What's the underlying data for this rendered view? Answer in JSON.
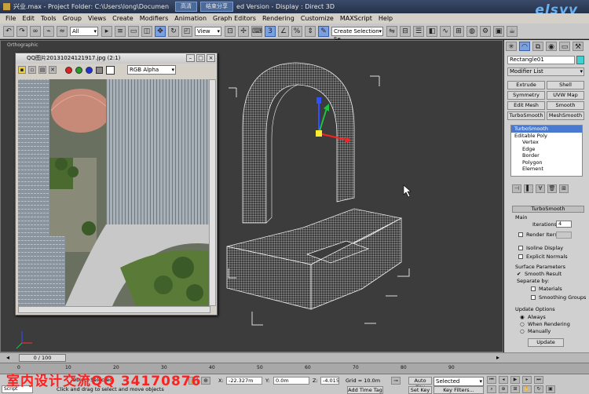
{
  "window": {
    "title": "兴业.max    - Project Folder: C:\\Users\\long\\Documen",
    "title_tail": "ed Version    - Display : Direct 3D",
    "buttons": [
      "高清",
      "结束分享"
    ],
    "logo": "elsyy"
  },
  "menu": [
    "File",
    "Edit",
    "Tools",
    "Group",
    "Views",
    "Create",
    "Modifiers",
    "Animation",
    "Graph Editors",
    "Rendering",
    "Customize",
    "MAXScript",
    "Help"
  ],
  "toolbar": {
    "filter": "All",
    "refcoord": "View",
    "selset": "Create Selection Se"
  },
  "viewport": {
    "label": "Orthographic"
  },
  "frame_window": {
    "title": "QQ图片20131024121917.jpg (2:1)",
    "channel": "RGB Alpha"
  },
  "command_panel": {
    "object_name": "Rectangle01",
    "modifier_list": "Modifier List",
    "buttons": [
      "Extrude",
      "Shell",
      "Symmetry",
      "UVW Map",
      "Edit Mesh",
      "Smooth",
      "TurboSmooth",
      "MeshSmooth"
    ],
    "stack": [
      {
        "label": "TurboSmooth",
        "highlight": true,
        "sub": false
      },
      {
        "label": "Editable Poly",
        "highlight": false,
        "sub": false
      },
      {
        "label": "Vertex",
        "highlight": false,
        "sub": true
      },
      {
        "label": "Edge",
        "highlight": false,
        "sub": true
      },
      {
        "label": "Border",
        "highlight": false,
        "sub": true
      },
      {
        "label": "Polygon",
        "highlight": false,
        "sub": true
      },
      {
        "label": "Element",
        "highlight": false,
        "sub": true
      }
    ],
    "rollout_title": "TurboSmooth",
    "main": {
      "title": "Main",
      "iterations_label": "Iterations:",
      "iterations_value": "4",
      "render_iters": "Render Iters:",
      "render_iters_value": "",
      "isoline": "Isoline Display",
      "explicit": "Explicit Normals"
    },
    "surface": {
      "title": "Surface Parameters",
      "smooth_result": "Smooth Result",
      "separate": "Separate by:",
      "materials": "Materials",
      "smoothing": "Smoothing Groups"
    },
    "update": {
      "title": "Update Options",
      "always": "Always",
      "when_rendering": "When Rendering",
      "manually": "Manually",
      "button": "Update"
    }
  },
  "timeline": {
    "counter": "0 / 100"
  },
  "ruler_ticks": [
    "0",
    "10",
    "20",
    "30",
    "40",
    "50",
    "60",
    "70",
    "80",
    "90"
  ],
  "status": {
    "selection": "Object Selected",
    "prompt": "Click and drag to select and move objects",
    "x": "-22.327m",
    "y": "0.0m",
    "z": "-4.015m",
    "grid": "Grid = 10.0m",
    "autokey": "Auto Key",
    "selected": "Selected",
    "setkey": "Set Key",
    "keyfilters": "Key Filters...",
    "add_time_tag": "Add Time Tag",
    "script": "Script"
  },
  "watermark": "室内设计交流QQ 34170876"
}
